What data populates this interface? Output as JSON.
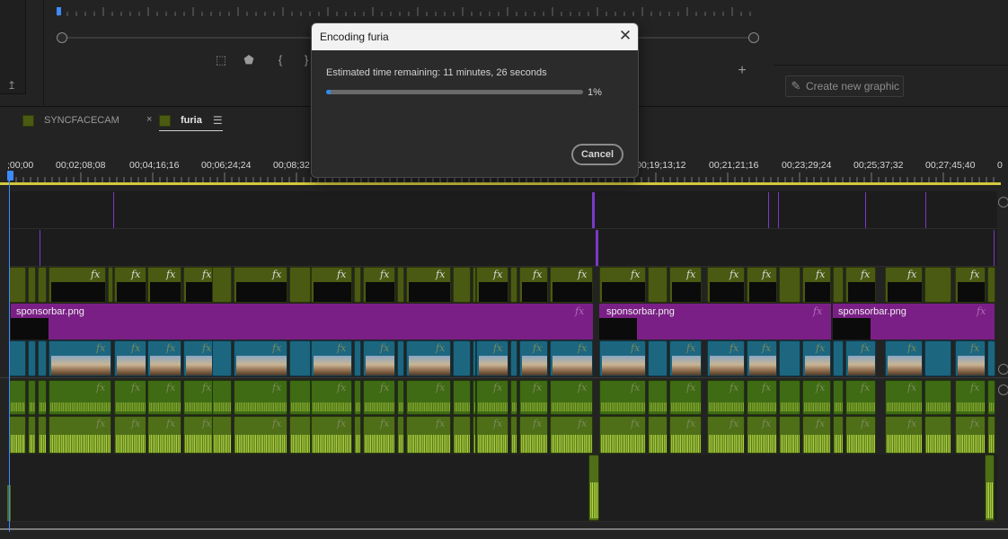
{
  "dialog": {
    "title": "Encoding furia",
    "close_icon": "close-icon",
    "estimate_text": "Estimated time remaining: 11 minutes, 26 seconds",
    "progress_fraction": 0.01,
    "progress_label": "1%",
    "cancel_label": "Cancel"
  },
  "graphics_panel": {
    "create_label": "Create new graphic",
    "create_icon": "pen-icon"
  },
  "sequence_tabs": [
    {
      "label": "SYNCFACECAM",
      "active": false
    },
    {
      "label": "furia",
      "active": true
    }
  ],
  "timeline": {
    "timecodes": [
      ";00;00",
      "00;02;08;08",
      "00;04;16;16",
      "00;06;24;24",
      "00;08;32",
      "00;19;13;12",
      "00;21;21;16",
      "00;23;29;24",
      "00;25;37;32",
      "00;27;45;40",
      "0"
    ],
    "graphic_clip_label": "sponsorbar.png",
    "fx_label": "fx"
  },
  "colors": {
    "playhead": "#3c8cff",
    "work_area_bar": "#d4c83c",
    "graphic_clip": "#7a1f86",
    "video_clip": "#1c6680",
    "audio_clip": "#3e6b13",
    "progress": "#2d8ceb"
  }
}
